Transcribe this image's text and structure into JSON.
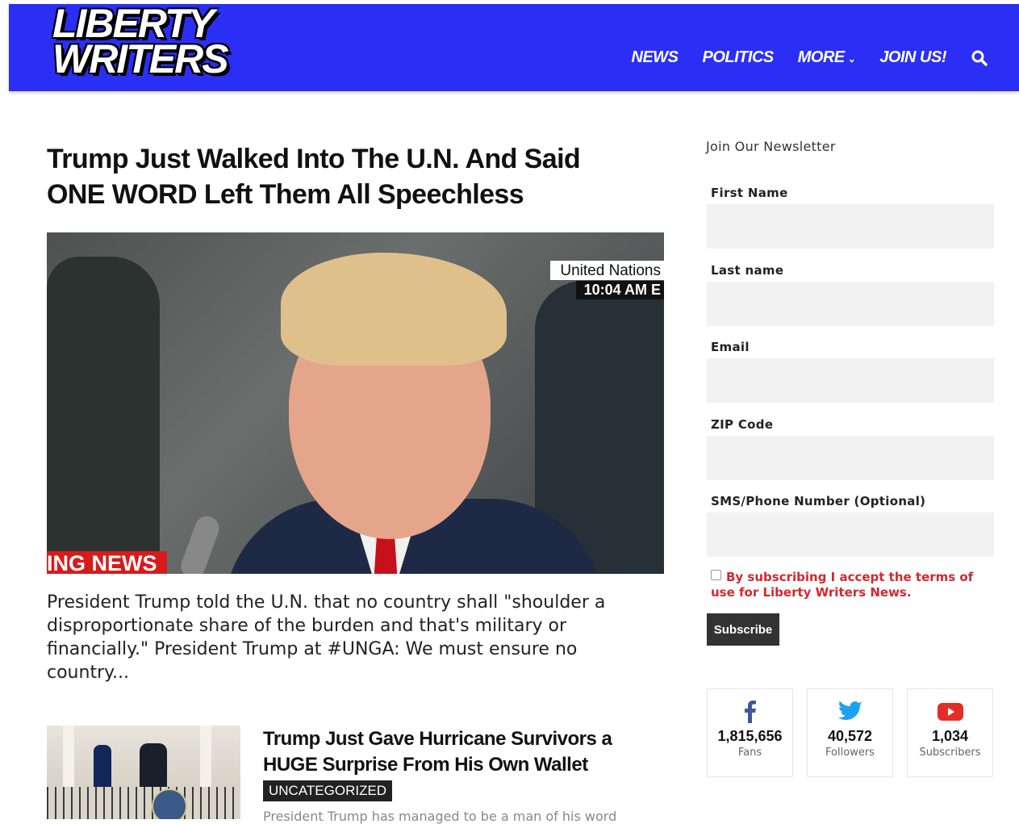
{
  "brand": {
    "logo_line1": "LIBERTY",
    "logo_line2": "WRITERS"
  },
  "nav": [
    {
      "label": "NEWS"
    },
    {
      "label": "POLITICS"
    },
    {
      "label": "MORE"
    },
    {
      "label": "JOIN US!"
    }
  ],
  "colors": {
    "header": "#2b2ff5",
    "accent_red": "#d3282d",
    "badge": "#222222"
  },
  "main_article": {
    "title": "Trump Just Walked Into The U.N. And Said ONE WORD Left Them All Speechless",
    "image_caption_location": "United Nations",
    "image_caption_time": "10:04 AM E",
    "image_ticker": "ING NEWS",
    "excerpt": "President Trump told the U.N. that no country shall \"shoulder a disproportionate share of the burden and that's military or financially.\" President Trump at #UNGA: We must ensure no country..."
  },
  "secondary_article": {
    "title": "Trump Just Gave Hurricane Survivors a HUGE Surprise From His Own Wallet",
    "category": "UNCATEGORIZED",
    "excerpt": "President Trump has managed to be a man of his word"
  },
  "newsletter": {
    "title": "Join Our Newsletter",
    "fields": [
      {
        "label": "First Name",
        "value": ""
      },
      {
        "label": "Last name",
        "value": ""
      },
      {
        "label": "Email",
        "value": ""
      },
      {
        "label": "ZIP Code",
        "value": ""
      },
      {
        "label": "SMS/Phone Number (Optional)",
        "value": ""
      }
    ],
    "consent_text": "By subscribing I accept the terms of use for Liberty Writers News.",
    "subscribe_label": "Subscribe"
  },
  "social": [
    {
      "icon": "facebook-icon",
      "count": "1,815,656",
      "label": "Fans",
      "color": "#3b5998"
    },
    {
      "icon": "twitter-icon",
      "count": "40,572",
      "label": "Followers",
      "color": "#1da1f2"
    },
    {
      "icon": "youtube-icon",
      "count": "1,034",
      "label": "Subscribers",
      "color": "#e52d27"
    }
  ]
}
